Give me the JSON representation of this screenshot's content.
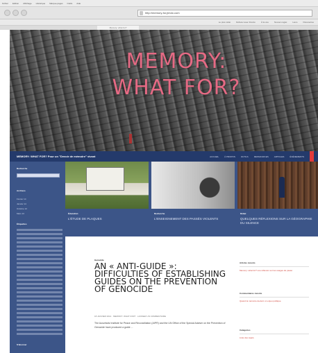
{
  "browser": {
    "menu": [
      "Fichier",
      "Edition",
      "Affichage",
      "Historique",
      "Marque-pages",
      "Outils",
      "Aide"
    ],
    "url": "http://memory-for.jimdo.com",
    "tab_title": "Memory: what for?",
    "bookmarks": [
      "Le plus visité",
      "Débuter avec Firefox",
      "À la une",
      "Nouvel onglet",
      "Liens",
      "Paramètres"
    ]
  },
  "hero": {
    "title_line1": "MEMORY:",
    "title_line2": "WHAT  FOR?"
  },
  "nav": {
    "site_title": "MEMORY: WHAT FOR? Pour un \"Devoir de mémoire\" vivant",
    "items": [
      "ACCUEIL",
      "À PROPOS",
      "OUTILS",
      "RESSOURCES",
      "ARTICLES",
      "ÉVÉNEMENTS"
    ]
  },
  "left_sidebar": {
    "search_label": "Recherche",
    "archives_label": "Archives",
    "archives": [
      "Février 14",
      "Janvier 14",
      "Octobre 13",
      "Mars 13"
    ],
    "tags_label": "Étiquettes",
    "subscribe_label": "S'abonner"
  },
  "featured": [
    {
      "category": "Éducation",
      "title": "L'ÉTUDE DE PLAQUES"
    },
    {
      "category": "Recherche",
      "title": "L'ENSEIGNEMENT DES PASSÉS VIOLENTS"
    },
    {
      "category": "Débat",
      "title": "QUELQUES RÉFLEXIONS SUR LA GÉOGRAPHIE DU SILENCE"
    }
  ],
  "post": {
    "category": "Genocide",
    "title": "AN « ANTI-GUIDE »: DIFFICULTIES OF ESTABLISHING GUIDES ON THE PREVENTION OF GENOCIDE",
    "meta": "18 JANVIER 2014   ·   MEMORY: WHAT FOR?   ·   LAISSER UN COMMENTAIRE",
    "excerpt": "The Auschwitz Institute for Peace and Reconciliation (AIPR) and the UN Office of the Special Adviser on the Prevention of Genocide have produced a guide ..."
  },
  "right_sidebar": {
    "sections": [
      {
        "heading": "Articles récents",
        "link": "Memory: what for? une réflexion sur les usages du passé"
      },
      {
        "heading": "Commentaires récents",
        "link": "Quand la mémoire devient un enjeu politique"
      },
      {
        "heading": "Catégories",
        "link": "Liste des sujets"
      }
    ]
  }
}
